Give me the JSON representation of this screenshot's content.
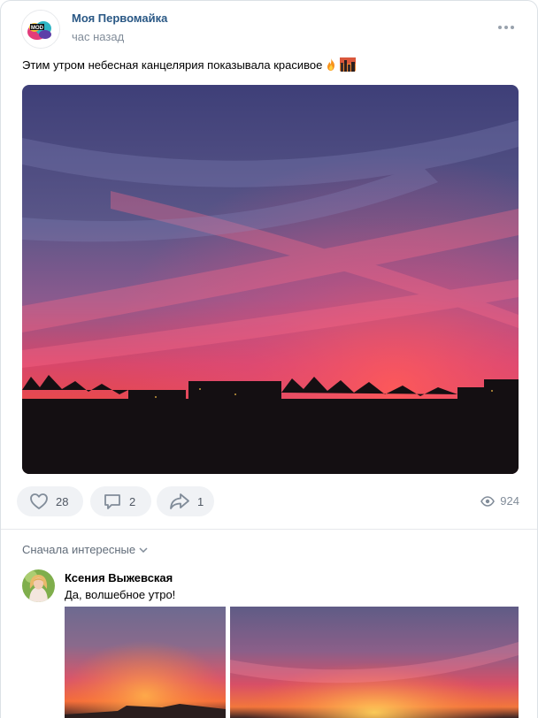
{
  "post": {
    "author": "Моя Первомайка",
    "time": "час назад",
    "text": "Этим утром небесная канцелярия показывала красивое",
    "text_emojis": [
      "fire-emoji",
      "city-sunset-emoji"
    ],
    "photo_alt": "photo"
  },
  "actions": {
    "likes": "28",
    "comments": "2",
    "shares": "1",
    "views": "924"
  },
  "comments_section": {
    "sort_label": "Сначала интересные",
    "comment": {
      "author": "Ксения Выжевская",
      "text": "Да, волшебное утро!"
    }
  },
  "colors": {
    "link": "#2a5885",
    "secondary": "#818c99",
    "pill_bg": "#f0f2f5",
    "icon": "#4f5763"
  }
}
